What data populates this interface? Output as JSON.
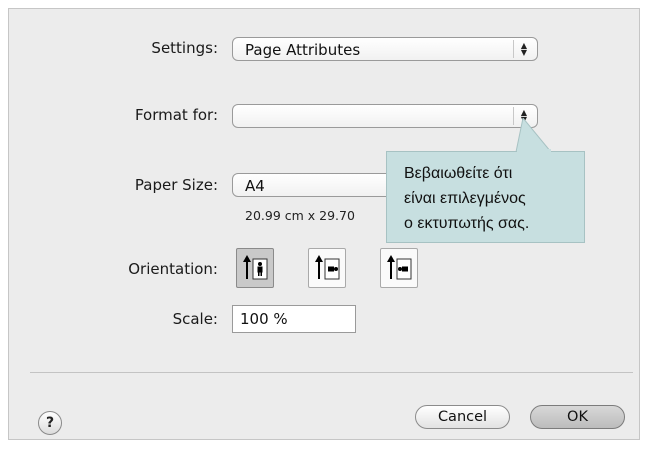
{
  "settings": {
    "label": "Settings:",
    "value": "Page Attributes"
  },
  "format_for": {
    "label": "Format for:",
    "value": ""
  },
  "paper_size": {
    "label": "Paper Size:",
    "value": "A4",
    "dimensions": "20.99 cm x 29.70"
  },
  "orientation": {
    "label": "Orientation:",
    "options": [
      {
        "name": "portrait",
        "selected": true
      },
      {
        "name": "landscape-left",
        "selected": false
      },
      {
        "name": "landscape-right",
        "selected": false
      }
    ]
  },
  "scale": {
    "label": "Scale:",
    "value": "100 %"
  },
  "buttons": {
    "help": "?",
    "cancel": "Cancel",
    "ok": "OK"
  },
  "tooltip": {
    "line1": "Βεβαιωθείτε ότι",
    "line2": "είναι επιλεγμένος",
    "line3": "ο εκτυπωτής σας."
  },
  "colors": {
    "tooltip_bg": "#c7dfe0",
    "dialog_bg": "#ececec"
  }
}
